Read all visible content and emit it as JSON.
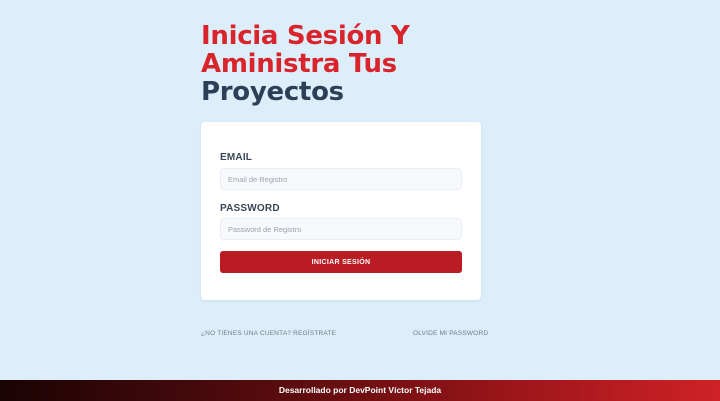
{
  "heading": {
    "line1": "Inicia Sesión Y",
    "line2": "Aministra Tus",
    "line3": "Proyectos"
  },
  "form": {
    "email_label": "EMAIL",
    "email_placeholder": "Email de Registro",
    "password_label": "PASSWORD",
    "password_placeholder": "Password de Registro",
    "submit_label": "INICIAR SESIÓN"
  },
  "links": {
    "register": "¿No tienes una cuenta? Regístrate",
    "forgot": "Olvide Mi Password"
  },
  "footer": {
    "text": "Desarrollado por DevPoint Víctor Tejada"
  },
  "colors": {
    "background": "#ddeefb",
    "accent_red": "#d8242a",
    "button_red": "#b91c22",
    "heading_dark": "#2d3f57"
  }
}
